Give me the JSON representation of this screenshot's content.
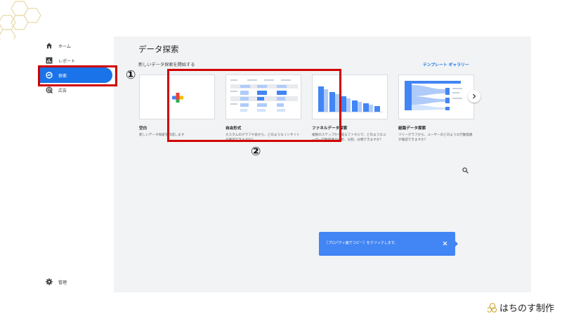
{
  "sidebar": {
    "items": [
      {
        "label": "ホーム",
        "icon": "home-icon"
      },
      {
        "label": "レポート",
        "icon": "reports-icon"
      },
      {
        "label": "探索",
        "icon": "explore-icon"
      },
      {
        "label": "広告",
        "icon": "advertising-icon"
      }
    ],
    "admin_label": "管理",
    "admin_icon": "gear-icon"
  },
  "main": {
    "title": "データ探索",
    "section_label": "新しいデータ探索を開始する",
    "gallery_link": "テンプレート ギャラリー",
    "cards": [
      {
        "title": "空白",
        "description": "新しいデータ探索を作成します"
      },
      {
        "title": "自由形式",
        "description": "カスタムのグラフや表から、どのようなインサイトが確認できますか？"
      },
      {
        "title": "ファネルデータ探索",
        "description": "複数のステップから成るファネルで、どのようなユーザー行動経路が分析、分割、分類できますか？"
      },
      {
        "title": "経路データ探索",
        "description": "ツリーグラフから、ユーザーのどのような行動経路が確認できますか？"
      }
    ],
    "toast": {
      "text": "［プロパティ面でコピー］をクリックします。"
    }
  },
  "annotations": {
    "one": "①",
    "two": "②"
  },
  "brand": {
    "name": "はちのす制作"
  },
  "colors": {
    "accent": "#1a73e8",
    "annotation": "#d00000",
    "toast": "#4285f4",
    "honeycomb": "#e8d9a8"
  }
}
